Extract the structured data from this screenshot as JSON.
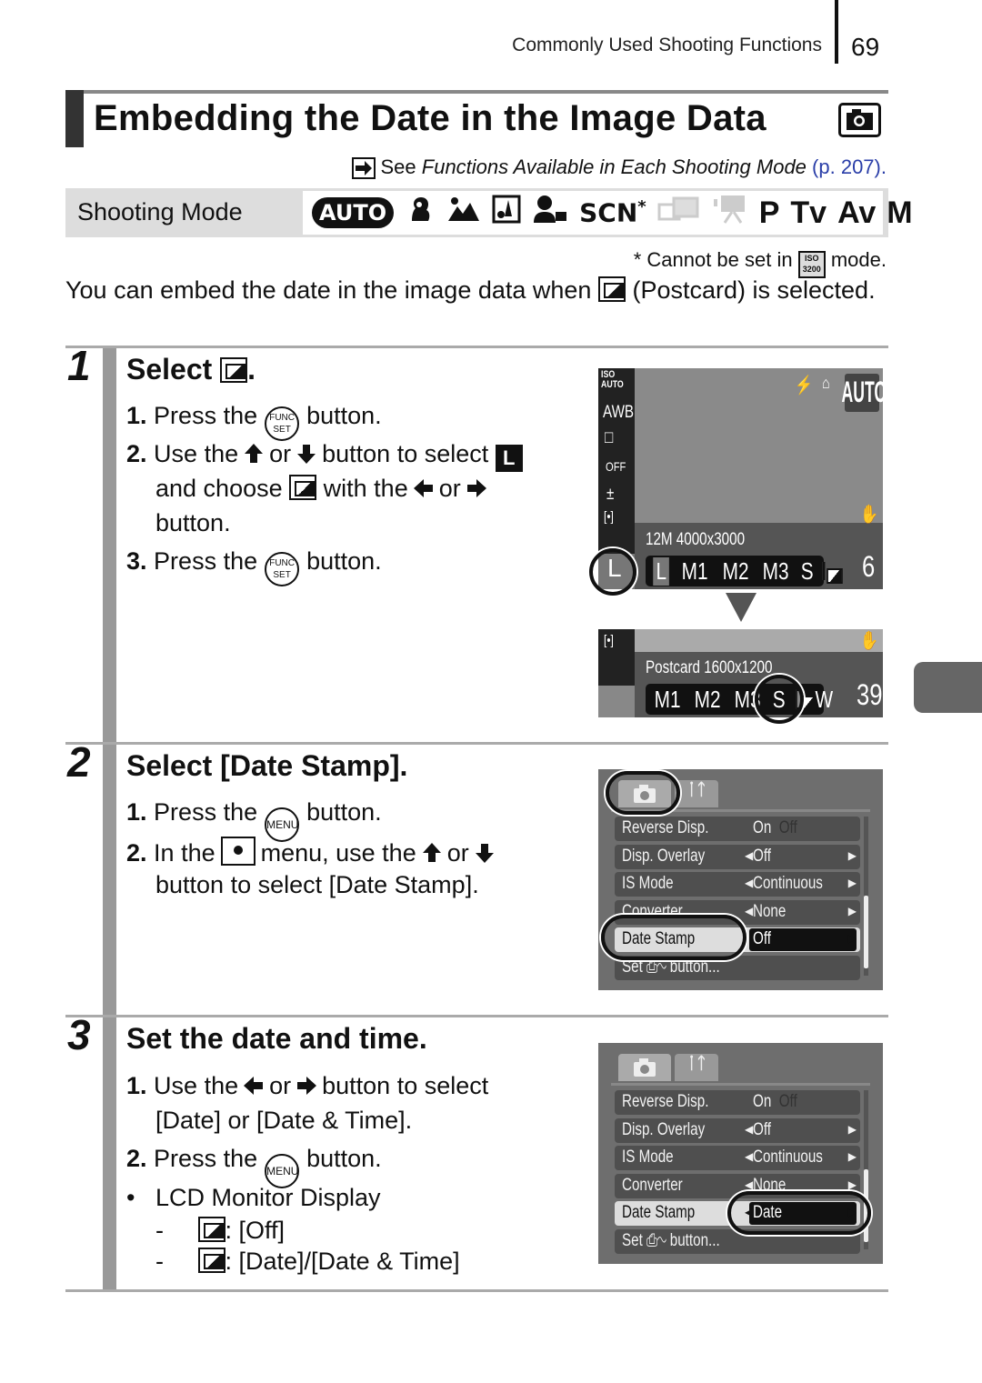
{
  "header": {
    "section": "Commonly Used Shooting Functions",
    "page": "69"
  },
  "title": "Embedding the Date in the Image Data",
  "title_icon": "camera-icon",
  "see_also": {
    "prefix": "See ",
    "italic": "Functions Available in Each Shooting Mode",
    "link": "(p. 207)",
    "suffix": "."
  },
  "shooting_mode": {
    "label": "Shooting Mode",
    "auto": "AUTO",
    "scn": "SCN",
    "scn_mark": "*",
    "modes": [
      "P",
      "Tv",
      "Av",
      "M"
    ],
    "icons": [
      "portrait-icon",
      "landscape-icon",
      "night-snapshot-icon",
      "kids-pets-icon",
      "stitch-assist-icon",
      "movie-icon"
    ],
    "available": {
      "stitch-assist": false,
      "movie": false
    }
  },
  "footnote": {
    "before": "* Cannot be set in",
    "iso_top": "ISO",
    "iso_bottom": "3200",
    "after": "mode."
  },
  "intro": {
    "before": "You can embed the date in the image data when",
    "after": "(Postcard) is selected."
  },
  "steps": [
    {
      "num": "1",
      "title": "Select",
      "title_suffix": ".",
      "lines": {
        "l1": {
          "n": "1.",
          "a": "Press the",
          "btn": [
            "FUNC",
            "SET"
          ],
          "b": "button."
        },
        "l2": {
          "n": "2.",
          "a": "Use the",
          "or": "or",
          "b": "button to select",
          "L": "L"
        },
        "l3": {
          "a": "and choose",
          "b": "with the",
          "or": "or"
        },
        "l4": {
          "a": "button."
        },
        "l5": {
          "n": "3.",
          "a": "Press the",
          "btn": [
            "FUNC",
            "SET"
          ],
          "b": "button."
        }
      },
      "screen1": {
        "iso": [
          "ISO",
          "AUTO"
        ],
        "left_icons": [
          "AWB",
          "□",
          "OFF",
          "±",
          "[•]"
        ],
        "mode": "AUTO",
        "info": "12M 4000x3000",
        "sizes": [
          "L",
          "M1",
          "M2",
          "M3",
          "S"
        ],
        "selected": "L",
        "current": "L",
        "shots": "6"
      },
      "screen2": {
        "info": "Postcard 1600x1200",
        "sizes": [
          "M1",
          "M2",
          "M3",
          "S"
        ],
        "wide": "W",
        "shots": "39"
      }
    },
    {
      "num": "2",
      "title": "Select [Date Stamp].",
      "lines": {
        "l1": {
          "n": "1.",
          "a": "Press the",
          "btn": "MENU",
          "b": "button."
        },
        "l2": {
          "n": "2.",
          "a": "In the",
          "b": "menu, use the",
          "or": "or"
        },
        "l3": {
          "a": "button to select [Date Stamp]."
        }
      },
      "menu": {
        "tabs": [
          "camera",
          "tools"
        ],
        "rows": [
          {
            "k": "Reverse Disp.",
            "v": "On",
            "v2": "Off"
          },
          {
            "k": "Disp. Overlay",
            "v": "Off"
          },
          {
            "k": "IS Mode",
            "v": "Continuous"
          },
          {
            "k": "Converter",
            "v": "None"
          },
          {
            "k": "Date Stamp",
            "v": "Off"
          },
          {
            "k": "Set",
            "k2": "button..."
          }
        ]
      }
    },
    {
      "num": "3",
      "title": "Set the date and time.",
      "lines": {
        "l1": {
          "n": "1.",
          "a": "Use the",
          "or": "or",
          "b": "button to select"
        },
        "l2": {
          "a": "[Date] or [Date & Time]."
        },
        "l3": {
          "n": "2.",
          "a": "Press the",
          "btn": "MENU",
          "b": "button."
        },
        "l4": {
          "bullet": "•",
          "a": "LCD Monitor Display"
        },
        "l5": {
          "dash": "-",
          "a": ": [Off]"
        },
        "l6": {
          "dash": "-",
          "a": ": [Date]/[Date & Time]"
        }
      },
      "menu": {
        "rows": [
          {
            "k": "Reverse Disp.",
            "v": "On",
            "v2": "Off"
          },
          {
            "k": "Disp. Overlay",
            "v": "Off"
          },
          {
            "k": "IS Mode",
            "v": "Continuous"
          },
          {
            "k": "Converter",
            "v": "None"
          },
          {
            "k": "Date Stamp",
            "v": "Date"
          },
          {
            "k": "Set",
            "k2": "button..."
          }
        ]
      }
    }
  ]
}
